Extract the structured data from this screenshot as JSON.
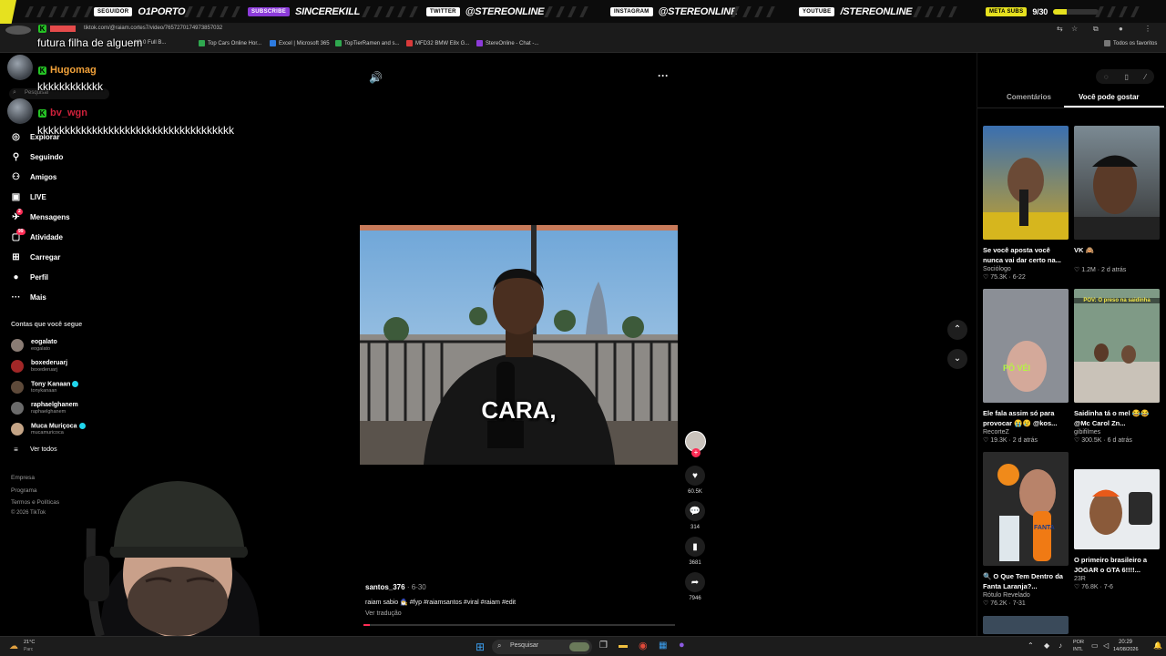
{
  "topbar": {
    "blocks": [
      {
        "tag": "SEGUIDOR",
        "value": "O1PORTO"
      },
      {
        "tag": "SUBSCRIBE",
        "value": "SINCEREKILL"
      },
      {
        "tag": "TWITTER",
        "value": "@STEREONLINE"
      },
      {
        "tag": "INSTAGRAM",
        "value": "@STEREONLINE"
      },
      {
        "tag": "YOUTUBE",
        "value": "/STEREONLINE"
      }
    ],
    "meta": {
      "tag": "META SUBS",
      "value": "9/30",
      "progress": 0.3
    }
  },
  "browser": {
    "url": "tiktok.com/@raiam.cortes7/video/7657270174973857032",
    "bookmarks": [
      "V2.0 Full B...",
      "Top Cars Online Hor...",
      "Excel | Microsoft 365",
      "TopTierRamen and s...",
      "MFD32 BMW E8x G...",
      "StereOnline - Chat -..."
    ],
    "favorites": "Todos os favoritos"
  },
  "chat": [
    {
      "user": "",
      "message": "futura filha de alguem",
      "color": "#e54b4b"
    },
    {
      "user": "Hugomag",
      "message": "kkkkkkkkkkkk",
      "color": "#f2a23a"
    },
    {
      "user": "bv_wgn",
      "message": "kkkkkkkkkkkkkkkkkkkkkkkkkkkkkkkkkkkk",
      "color": "#d0213b"
    }
  ],
  "sidebar": {
    "search_placeholder": "Pesquisar",
    "items": [
      {
        "label": "Explorar",
        "icon": "compass-icon"
      },
      {
        "label": "Seguindo",
        "icon": "person-follow-icon"
      },
      {
        "label": "Amigos",
        "icon": "friends-icon"
      },
      {
        "label": "LIVE",
        "icon": "live-icon"
      },
      {
        "label": "Mensagens",
        "icon": "message-icon",
        "badge": "2"
      },
      {
        "label": "Atividade",
        "icon": "activity-icon",
        "badge": "99"
      },
      {
        "label": "Carregar",
        "icon": "upload-icon"
      },
      {
        "label": "Perfil",
        "icon": "profile-icon"
      },
      {
        "label": "Mais",
        "icon": "more-icon"
      }
    ],
    "follow_heading": "Contas que você segue",
    "following": [
      {
        "name": "eogalato",
        "handle": "eogalato",
        "verified": false
      },
      {
        "name": "boxederuarj",
        "handle": "boxederuarj",
        "verified": false
      },
      {
        "name": "Tony Kanaan",
        "handle": "tonykanaan",
        "verified": true
      },
      {
        "name": "raphaelghanem",
        "handle": "raphaelghanem",
        "verified": false
      },
      {
        "name": "Muca Muriçoca",
        "handle": "mucamuricoca",
        "verified": true
      }
    ],
    "see_all": "Ver todos",
    "footer": [
      "Empresa",
      "Programa",
      "Termos e Políticas",
      "© 2026 TikTok"
    ]
  },
  "video": {
    "caption_overlay": "CARA,",
    "author": "santos_376",
    "date": "6-30",
    "description": "raiam sabio 🧙‍♂️ #fyp #raiamsantos #viral #raiam #edit",
    "translate": "Ver tradução",
    "progress": 0.02,
    "likes": "60.5K",
    "comments": "314",
    "saves": "3681",
    "shares": "7946"
  },
  "right_panel": {
    "tabs": [
      "Comentários",
      "Você pode gostar"
    ],
    "active_tab": "Você pode gostar",
    "recommendations": [
      {
        "title": "Se você aposta você nunca vai dar certo na...",
        "author": "Sociólogo",
        "likes": "75.3K",
        "age": "6-22",
        "thumb_text": ""
      },
      {
        "title": "VK 🙈",
        "author": "",
        "likes": "1.2M",
        "age": "2 d atrás",
        "thumb_text": ""
      },
      {
        "title": "Ele fala assim só para provocar 😭😢 @kos...",
        "author": "RecorteZ",
        "likes": "19.3K",
        "age": "2 d atrás",
        "thumb_text": "PÔ VÉI"
      },
      {
        "title": "Saidinha tá o mel 😂😂 @Mc Carol Zn...",
        "author": "gibifilmes",
        "likes": "300.5K",
        "age": "6 d atrás",
        "thumb_text": "POV: O preso na saidinha"
      },
      {
        "title": "🔍 O Que Tem Dentro da Fanta Laranja?...",
        "author": "Rótulo Revelado",
        "likes": "76.2K",
        "age": "7-31",
        "thumb_text": "FANTA"
      },
      {
        "title": "O primeiro brasileiro a JOGAR o GTA 6!!!!...",
        "author": "23R",
        "likes": "76.8K",
        "age": "7-6",
        "thumb_text": ""
      }
    ]
  },
  "taskbar": {
    "weather": "21°C",
    "weather_sub": "Parc",
    "search": "Pesquisar",
    "lang": "POR",
    "lang_sub": "INTL",
    "time": "20:29",
    "date": "14/08/2026"
  }
}
